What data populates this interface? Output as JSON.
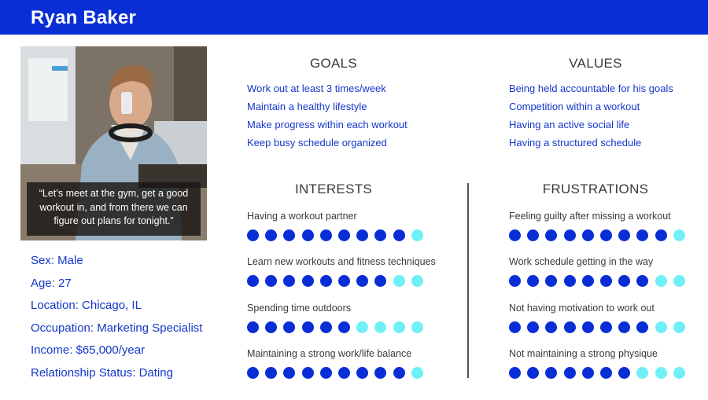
{
  "persona": {
    "name": "Ryan Baker",
    "quote": "“Let’s meet at the gym, get a good workout in, and from there we can figure out plans for tonight.”"
  },
  "demographics": [
    {
      "text": "Sex: Male"
    },
    {
      "text": "Age: 27"
    },
    {
      "text": "Location: Chicago, IL"
    },
    {
      "text": "Occupation: Marketing Specialist"
    },
    {
      "text": "Income: $65,000/year"
    },
    {
      "text": "Relationship Status: Dating"
    }
  ],
  "goals": {
    "title": "GOALS",
    "items": [
      "Work out at least 3 times/week",
      "Maintain a healthy lifestyle",
      "Make progress within each workout",
      "Keep busy schedule organized"
    ]
  },
  "values": {
    "title": "VALUES",
    "items": [
      "Being held accountable for his goals",
      "Competition within a workout",
      "Having an active social life",
      "Having a structured schedule"
    ]
  },
  "interests": {
    "title": "INTERESTS",
    "items": [
      {
        "label": "Having a workout partner",
        "rating": 9,
        "scale": 10
      },
      {
        "label": "Learn new workouts and fitness techniques",
        "rating": 8,
        "scale": 10
      },
      {
        "label": "Spending time outdoors",
        "rating": 6,
        "scale": 10
      },
      {
        "label": "Maintaining a strong work/life balance",
        "rating": 9,
        "scale": 10
      }
    ]
  },
  "frustrations": {
    "title": "FRUSTRATIONS",
    "items": [
      {
        "label": "Feeling guilty after missing a workout",
        "rating": 9,
        "scale": 10
      },
      {
        "label": "Work schedule getting in the way",
        "rating": 8,
        "scale": 10
      },
      {
        "label": "Not having motivation to work out",
        "rating": 8,
        "scale": 10
      },
      {
        "label": "Not maintaining a strong physique",
        "rating": 7,
        "scale": 10
      }
    ]
  },
  "colors": {
    "accent": "#0a2ed6",
    "dot_filled": "#0a2ed6",
    "dot_empty": "#6ff0f7",
    "link_text": "#1437c9"
  }
}
